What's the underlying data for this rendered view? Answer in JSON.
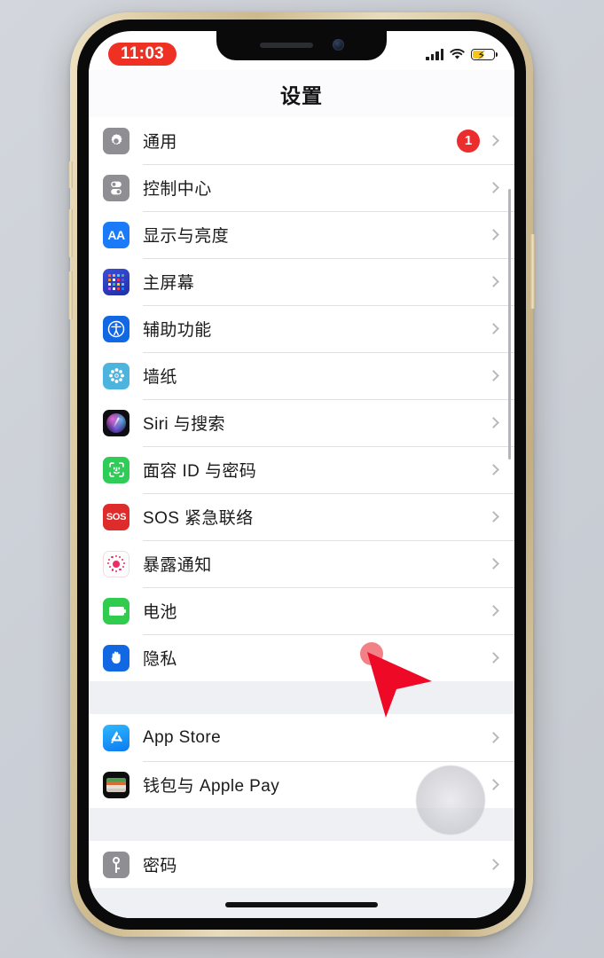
{
  "device": {
    "frame_color": "#dccba3",
    "screen_bg": "#ffffff"
  },
  "status_bar": {
    "time": "11:03",
    "time_pill_color": "#ef3124",
    "signal_icon": "cellular-signal-icon",
    "wifi_icon": "wifi-icon",
    "battery_icon": "battery-charging-icon",
    "battery_color": "#f5c518"
  },
  "nav": {
    "title": "设置"
  },
  "sections": [
    {
      "rows": [
        {
          "label": "通用",
          "icon": "gear-icon",
          "badge": "1",
          "chevron": true
        },
        {
          "label": "控制中心",
          "icon": "control-center-icon",
          "badge": "",
          "chevron": true
        },
        {
          "label": "显示与亮度",
          "icon": "display-brightness-icon",
          "badge": "",
          "chevron": true
        },
        {
          "label": "主屏幕",
          "icon": "home-screen-icon",
          "badge": "",
          "chevron": true
        },
        {
          "label": "辅助功能",
          "icon": "accessibility-icon",
          "badge": "",
          "chevron": true
        },
        {
          "label": "墙纸",
          "icon": "wallpaper-icon",
          "badge": "",
          "chevron": true
        },
        {
          "label": "Siri 与搜索",
          "icon": "siri-icon",
          "badge": "",
          "chevron": true
        },
        {
          "label": "面容 ID 与密码",
          "icon": "face-id-icon",
          "badge": "",
          "chevron": true
        },
        {
          "label": "SOS 紧急联络",
          "icon": "sos-icon",
          "badge": "",
          "chevron": true
        },
        {
          "label": "暴露通知",
          "icon": "exposure-notification-icon",
          "badge": "",
          "chevron": true
        },
        {
          "label": "电池",
          "icon": "battery-icon",
          "badge": "",
          "chevron": true
        },
        {
          "label": "隐私",
          "icon": "privacy-hand-icon",
          "badge": "",
          "chevron": true
        }
      ]
    },
    {
      "rows": [
        {
          "label": "App Store",
          "icon": "app-store-icon",
          "badge": "",
          "chevron": true
        },
        {
          "label": "钱包与 Apple Pay",
          "icon": "wallet-icon",
          "badge": "",
          "chevron": true
        }
      ]
    },
    {
      "rows": [
        {
          "label": "密码",
          "icon": "passwords-key-icon",
          "badge": "",
          "chevron": true
        }
      ]
    }
  ],
  "overlays": {
    "cursor": {
      "name": "red-arrow-cursor",
      "color": "#ee0a26"
    },
    "assistive_touch": {
      "name": "assistive-touch-button"
    },
    "scroll_indicator": {
      "name": "scroll-indicator"
    },
    "home_indicator": {
      "name": "home-indicator"
    }
  }
}
